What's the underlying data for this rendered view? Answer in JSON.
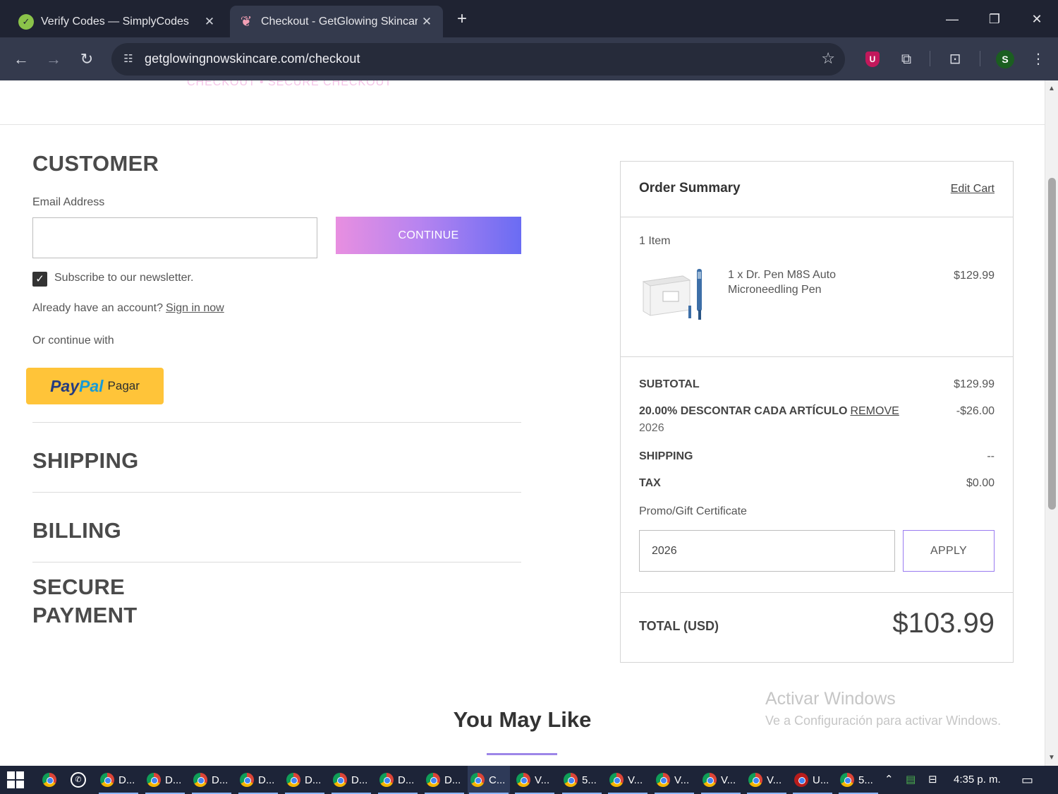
{
  "browser": {
    "tabs": [
      {
        "title": "Verify Codes — SimplyCodes",
        "active": false,
        "close": "✕"
      },
      {
        "title": "Checkout - GetGlowing Skincare",
        "active": true,
        "close": "✕"
      }
    ],
    "new_tab": "+",
    "window_controls": {
      "minimize": "—",
      "restore": "❐",
      "close": "✕"
    },
    "url": "getglowingnowskincare.com/checkout",
    "profile_initial": "S",
    "extension_badge": "U"
  },
  "page": {
    "header_faded": "CHECKOUT • SECURE CHECKOUT",
    "customer": {
      "heading": "CUSTOMER",
      "email_label": "Email Address",
      "email_value": "",
      "continue_label": "CONTINUE",
      "newsletter_label": "Subscribe to our newsletter.",
      "newsletter_checked": true,
      "already_text": "Already have an account?",
      "signin_label": "Sign in now",
      "or_continue": "Or continue with",
      "paypal_pay": "Pay",
      "paypal_pal": "Pal",
      "paypal_action": "Pagar"
    },
    "sections": [
      "SHIPPING",
      "BILLING",
      "SECURE",
      "PAYMENT"
    ],
    "summary": {
      "title": "Order Summary",
      "edit_cart": "Edit Cart",
      "item_count": "1 Item",
      "product_name": "1 x Dr. Pen M8S Auto Microneedling Pen",
      "product_price": "$129.99",
      "subtotal_label": "SUBTOTAL",
      "subtotal_value": "$129.99",
      "discount_label": "20.00% DESCONTAR CADA ARTÍCULO",
      "discount_remove": "REMOVE",
      "discount_code": "2026",
      "discount_value": "-$26.00",
      "shipping_label": "SHIPPING",
      "shipping_value": "--",
      "tax_label": "TAX",
      "tax_value": "$0.00",
      "promo_label": "Promo/Gift Certificate",
      "promo_value": "2026",
      "apply_label": "APPLY",
      "total_label": "TOTAL (USD)",
      "total_value": "$103.99"
    },
    "you_may_like": "You May Like",
    "watermark_title": "Activar Windows",
    "watermark_sub": "Ve a Configuración para activar Windows."
  },
  "taskbar": {
    "apps": [
      "D...",
      "D...",
      "D...",
      "D...",
      "D...",
      "D...",
      "D...",
      "D...",
      "C...",
      "V...",
      "5...",
      "V...",
      "V...",
      "V...",
      "V...",
      "U...",
      "5..."
    ],
    "clock": "4:35 p. m."
  }
}
